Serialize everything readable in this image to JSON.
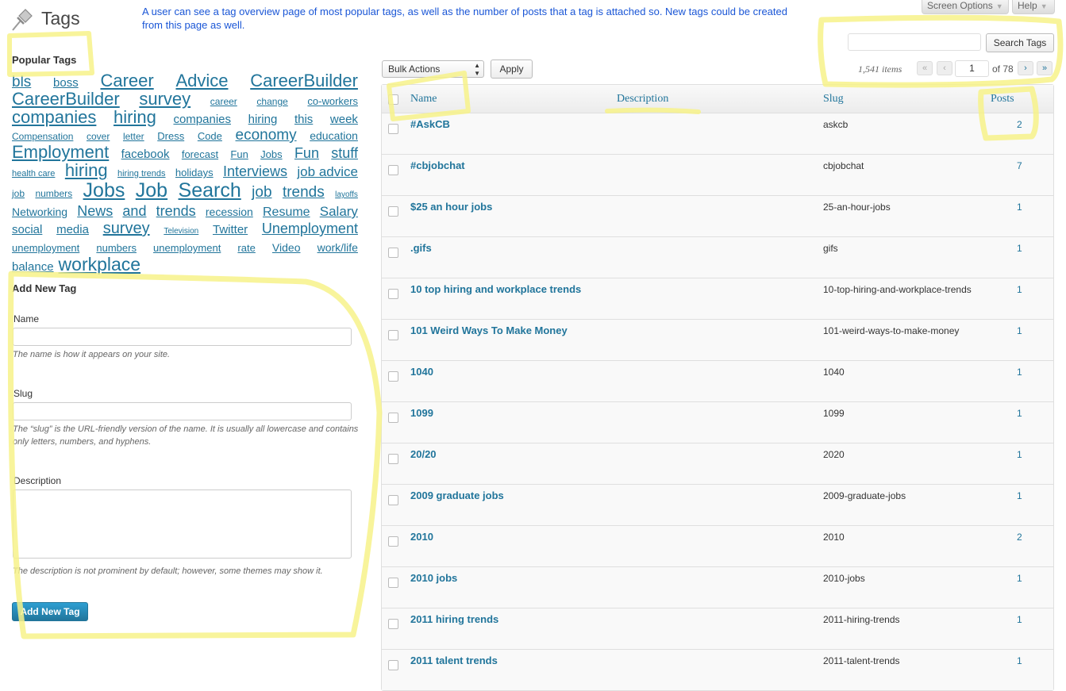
{
  "header": {
    "title": "Tags",
    "note": "A user can see a tag overview page of most popular tags, as well as the number of posts that a tag is attached so. New tags could be created from this page as well.",
    "screen_options": "Screen Options",
    "help": "Help"
  },
  "search": {
    "button": "Search Tags",
    "value": ""
  },
  "pagination": {
    "items": "1,541 items",
    "first": "«",
    "prev": "‹",
    "current": "1",
    "of": "of 78",
    "next": "›",
    "last": "»"
  },
  "bulk": {
    "selected": "Bulk Actions",
    "apply": "Apply"
  },
  "table": {
    "columns": {
      "name": "Name",
      "description": "Description",
      "slug": "Slug",
      "posts": "Posts"
    },
    "rows": [
      {
        "name": "#AskCB",
        "slug": "askcb",
        "posts": "2"
      },
      {
        "name": "#cbjobchat",
        "slug": "cbjobchat",
        "posts": "7"
      },
      {
        "name": "$25 an hour jobs",
        "slug": "25-an-hour-jobs",
        "posts": "1"
      },
      {
        "name": ".gifs",
        "slug": "gifs",
        "posts": "1"
      },
      {
        "name": "10 top hiring and workplace trends",
        "slug": "10-top-hiring-and-workplace-trends",
        "posts": "1"
      },
      {
        "name": "101 Weird Ways To Make Money",
        "slug": "101-weird-ways-to-make-money",
        "posts": "1"
      },
      {
        "name": "1040",
        "slug": "1040",
        "posts": "1"
      },
      {
        "name": "1099",
        "slug": "1099",
        "posts": "1"
      },
      {
        "name": "20/20",
        "slug": "2020",
        "posts": "1"
      },
      {
        "name": "2009 graduate jobs",
        "slug": "2009-graduate-jobs",
        "posts": "1"
      },
      {
        "name": "2010",
        "slug": "2010",
        "posts": "2"
      },
      {
        "name": "2010 jobs",
        "slug": "2010-jobs",
        "posts": "1"
      },
      {
        "name": "2011 hiring trends",
        "slug": "2011-hiring-trends",
        "posts": "1"
      },
      {
        "name": "2011 talent trends",
        "slug": "2011-talent-trends",
        "posts": "1"
      }
    ]
  },
  "popular": {
    "heading": "Popular Tags",
    "lines": [
      [
        {
          "t": "bls",
          "s": 19
        },
        {
          "t": "boss",
          "s": 15
        },
        {
          "t": "Career",
          "s": 22
        },
        {
          "t": "Advice",
          "s": 22
        },
        {
          "t": "CareerBuilder",
          "s": 22
        }
      ],
      [
        {
          "t": "CareerBuilder",
          "s": 22
        },
        {
          "t": "survey",
          "s": 22
        },
        {
          "t": "career",
          "s": 12
        },
        {
          "t": "change",
          "s": 12
        },
        {
          "t": "co-workers",
          "s": 13
        }
      ],
      [
        {
          "t": "companies",
          "s": 22
        },
        {
          "t": "hiring",
          "s": 22
        },
        {
          "t": "companies",
          "s": 15
        },
        {
          "t": "hiring",
          "s": 15
        },
        {
          "t": "this",
          "s": 15
        },
        {
          "t": "week",
          "s": 15
        }
      ],
      [
        {
          "t": "Compensation",
          "s": 12
        },
        {
          "t": "cover",
          "s": 12
        },
        {
          "t": "letter",
          "s": 12
        },
        {
          "t": "Dress",
          "s": 13
        },
        {
          "t": "Code",
          "s": 13
        },
        {
          "t": "economy",
          "s": 19
        },
        {
          "t": "education",
          "s": 14
        }
      ],
      [
        {
          "t": "Employment",
          "s": 22
        },
        {
          "t": "facebook",
          "s": 15
        },
        {
          "t": "forecast",
          "s": 13
        },
        {
          "t": "Fun",
          "s": 13
        },
        {
          "t": "Jobs",
          "s": 13
        },
        {
          "t": "Fun",
          "s": 18
        },
        {
          "t": "stuff",
          "s": 18
        }
      ],
      [
        {
          "t": "health care",
          "s": 11
        },
        {
          "t": "hiring",
          "s": 22
        },
        {
          "t": "hiring trends",
          "s": 11
        },
        {
          "t": "holidays",
          "s": 13
        },
        {
          "t": "Interviews",
          "s": 18
        },
        {
          "t": "job advice",
          "s": 17
        }
      ],
      [
        {
          "t": "job",
          "s": 12
        },
        {
          "t": "numbers",
          "s": 12
        },
        {
          "t": "Jobs",
          "s": 25
        },
        {
          "t": "Job",
          "s": 25
        },
        {
          "t": "Search",
          "s": 25
        },
        {
          "t": "job",
          "s": 19
        },
        {
          "t": "trends",
          "s": 19
        },
        {
          "t": "layoffs",
          "s": 10
        }
      ],
      [
        {
          "t": "Networking",
          "s": 14
        },
        {
          "t": "News",
          "s": 18
        },
        {
          "t": "and",
          "s": 18
        },
        {
          "t": "trends",
          "s": 18
        },
        {
          "t": "recession",
          "s": 14
        },
        {
          "t": "Resume",
          "s": 16
        },
        {
          "t": "Salary",
          "s": 17
        }
      ],
      [
        {
          "t": "social",
          "s": 15
        },
        {
          "t": "media",
          "s": 15
        },
        {
          "t": "survey",
          "s": 20
        },
        {
          "t": "Television",
          "s": 10
        },
        {
          "t": "Twitter",
          "s": 15
        },
        {
          "t": "Unemployment",
          "s": 18
        }
      ],
      [
        {
          "t": "unemployment",
          "s": 13
        },
        {
          "t": "numbers",
          "s": 13
        },
        {
          "t": "unemployment",
          "s": 13
        },
        {
          "t": "rate",
          "s": 13
        },
        {
          "t": "Video",
          "s": 14
        },
        {
          "t": "work/life",
          "s": 14
        }
      ],
      [
        {
          "t": "balance",
          "s": 15
        },
        {
          "t": "workplace",
          "s": 23
        }
      ]
    ]
  },
  "form": {
    "heading": "Add New Tag",
    "name_label": "Name",
    "name_hint": "The name is how it appears on your site.",
    "slug_label": "Slug",
    "slug_hint": "The “slug” is the URL-friendly version of the name. It is usually all lowercase and contains only letters, numbers, and hyphens.",
    "desc_label": "Description",
    "desc_hint": "The description is not prominent by default; however, some themes may show it.",
    "submit": "Add New Tag"
  },
  "colors": {
    "link": "#21759b",
    "note": "#1a56d6",
    "highlight": "#f7f28a"
  }
}
